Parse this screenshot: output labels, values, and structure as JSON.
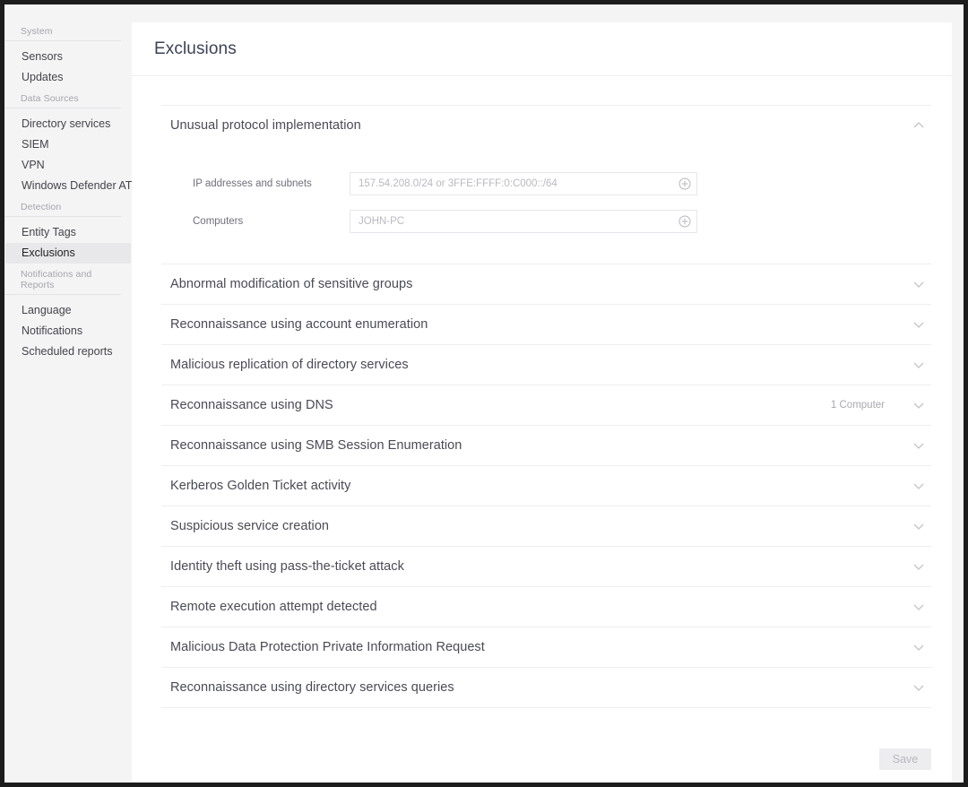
{
  "sidebar": {
    "groups": [
      {
        "title": "System",
        "items": [
          {
            "label": "Sensors",
            "selected": false
          },
          {
            "label": "Updates",
            "selected": false
          }
        ]
      },
      {
        "title": "Data Sources",
        "items": [
          {
            "label": "Directory services",
            "selected": false
          },
          {
            "label": "SIEM",
            "selected": false
          },
          {
            "label": "VPN",
            "selected": false
          },
          {
            "label": "Windows Defender ATP",
            "selected": false
          }
        ]
      },
      {
        "title": "Detection",
        "items": [
          {
            "label": "Entity Tags",
            "selected": false
          },
          {
            "label": "Exclusions",
            "selected": true
          }
        ]
      },
      {
        "title": "Notifications and Reports",
        "items": [
          {
            "label": "Language",
            "selected": false
          },
          {
            "label": "Notifications",
            "selected": false
          },
          {
            "label": "Scheduled reports",
            "selected": false
          }
        ]
      }
    ]
  },
  "header": {
    "title": "Exclusions"
  },
  "exclusions": [
    {
      "title": "Unusual protocol implementation",
      "expanded": true,
      "count": "",
      "chevron_icon": "chevron-up-icon",
      "fields": [
        {
          "label": "IP addresses and subnets",
          "value": "",
          "placeholder": "157.54.208.0/24 or 3FFE:FFFF:0:C000::/64",
          "add_icon": "circle-plus-icon"
        },
        {
          "label": "Computers",
          "value": "",
          "placeholder": "JOHN-PC",
          "add_icon": "circle-plus-icon"
        }
      ]
    },
    {
      "title": "Abnormal modification of sensitive groups",
      "expanded": false,
      "count": "",
      "chevron_icon": "chevron-down-icon",
      "fields": []
    },
    {
      "title": "Reconnaissance using account enumeration",
      "expanded": false,
      "count": "",
      "chevron_icon": "chevron-down-icon",
      "fields": []
    },
    {
      "title": "Malicious replication of directory services",
      "expanded": false,
      "count": "",
      "chevron_icon": "chevron-down-icon",
      "fields": []
    },
    {
      "title": "Reconnaissance using DNS",
      "expanded": false,
      "count": "1 Computer",
      "chevron_icon": "chevron-down-icon",
      "fields": []
    },
    {
      "title": "Reconnaissance using SMB Session Enumeration",
      "expanded": false,
      "count": "",
      "chevron_icon": "chevron-down-icon",
      "fields": []
    },
    {
      "title": "Kerberos Golden Ticket activity",
      "expanded": false,
      "count": "",
      "chevron_icon": "chevron-down-icon",
      "fields": []
    },
    {
      "title": "Suspicious service creation",
      "expanded": false,
      "count": "",
      "chevron_icon": "chevron-down-icon",
      "fields": []
    },
    {
      "title": "Identity theft using pass-the-ticket attack",
      "expanded": false,
      "count": "",
      "chevron_icon": "chevron-down-icon",
      "fields": []
    },
    {
      "title": "Remote execution attempt detected",
      "expanded": false,
      "count": "",
      "chevron_icon": "chevron-down-icon",
      "fields": []
    },
    {
      "title": "Malicious Data Protection Private Information Request",
      "expanded": false,
      "count": "",
      "chevron_icon": "chevron-down-icon",
      "fields": []
    },
    {
      "title": "Reconnaissance using directory services queries",
      "expanded": false,
      "count": "",
      "chevron_icon": "chevron-down-icon",
      "fields": []
    }
  ],
  "footer": {
    "save_label": "Save",
    "save_disabled": true
  },
  "colors": {
    "page_background": "#f4f4f5",
    "card_background": "#ffffff",
    "selected_item_background": "#e8e8ea",
    "divider": "#eeeef1",
    "title_text": "#3c4257",
    "muted_text": "#a5a5ab"
  }
}
